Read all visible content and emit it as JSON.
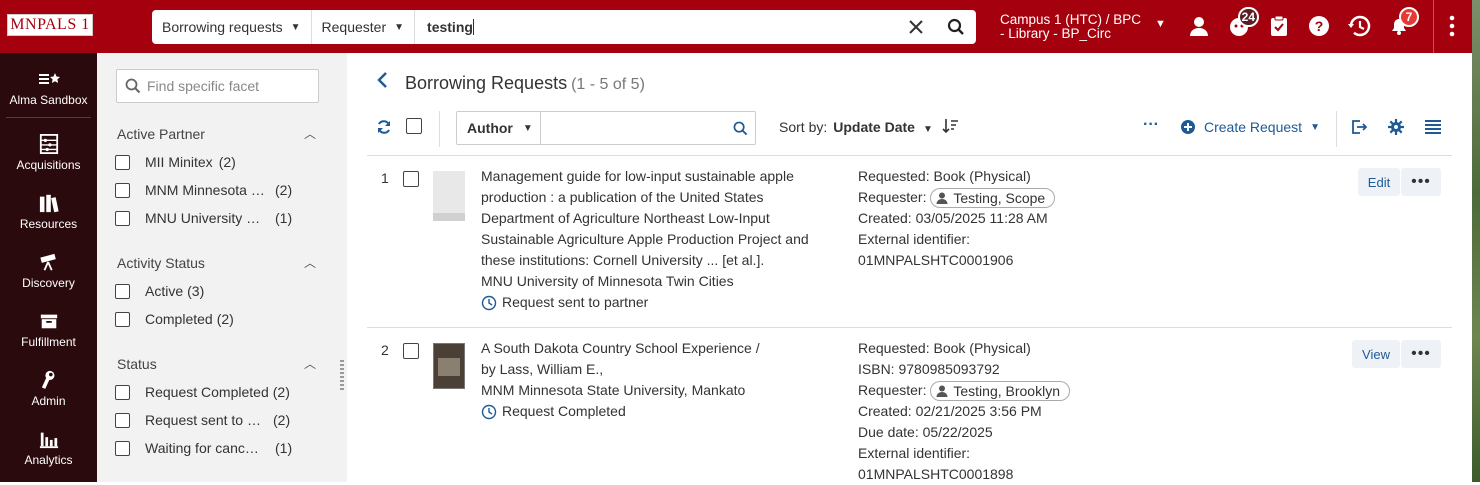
{
  "header": {
    "logo": "MNPALS 1",
    "search": {
      "scope": "Borrowing requests",
      "field": "Requester",
      "query": "testing"
    },
    "campus_line1": "Campus 1 (HTC) / BPC",
    "campus_line2": "- Library - BP_Circ",
    "tasks_badge": "24",
    "notifications_badge": "7"
  },
  "left_nav": [
    {
      "label": "Alma Sandbox",
      "icon": "sandbox-icon"
    },
    {
      "label": "Acquisitions",
      "icon": "abacus-icon"
    },
    {
      "label": "Resources",
      "icon": "books-icon"
    },
    {
      "label": "Discovery",
      "icon": "telescope-icon"
    },
    {
      "label": "Fulfillment",
      "icon": "inbox-icon"
    },
    {
      "label": "Admin",
      "icon": "wrench-icon"
    },
    {
      "label": "Analytics",
      "icon": "bar-chart-icon"
    }
  ],
  "facets": {
    "search_placeholder": "Find specific facet",
    "groups": [
      {
        "title": "Active Partner",
        "items": [
          {
            "label": "MII Minitex",
            "count": "(2)"
          },
          {
            "label": "MNM Minnesota State University, Mankato",
            "count": "(2)"
          },
          {
            "label": "MNU University of Minnesota Twin Cities",
            "count": "(1)"
          }
        ]
      },
      {
        "title": "Activity Status",
        "items": [
          {
            "label": "Active",
            "count": "(3)"
          },
          {
            "label": "Completed",
            "count": "(2)"
          }
        ]
      },
      {
        "title": "Status",
        "items": [
          {
            "label": "Request Completed",
            "count": "(2)"
          },
          {
            "label": "Request sent to partner",
            "count": "(2)"
          },
          {
            "label": "Waiting for cancellation",
            "count": "(1)"
          }
        ]
      }
    ]
  },
  "main": {
    "title": "Borrowing Requests",
    "count": "(1 - 5 of 5)",
    "filter_field": "Author",
    "sort_label": "Sort by:",
    "sort_value": "Update Date",
    "more": "···",
    "create_label": "Create Request"
  },
  "rows": [
    {
      "num": "1",
      "title": "Management guide for low-input sustainable apple production : a publication of the United States Department of Agriculture Northeast Low-Input Sustainable Agriculture Apple Production Project and these institutions: Cornell University ... [et al.].",
      "partner": "MNU University of Minnesota Twin Cities",
      "status": "Request sent to partner",
      "requested_label": "Requested:",
      "requested": "Book (Physical)",
      "requester_label": "Requester:",
      "requester": "Testing, Scope",
      "created_label": "Created:",
      "created": "03/05/2025 11:28 AM",
      "ext_label": "External identifier:",
      "ext_id": "01MNPALSHTC0001906",
      "action": "Edit"
    },
    {
      "num": "2",
      "title": "A South Dakota Country School Experience /",
      "author_line": "by Lass, William E.,",
      "partner": "MNM Minnesota State University, Mankato",
      "status": "Request Completed",
      "requested_label": "Requested:",
      "requested": "Book (Physical)",
      "isbn_label": "ISBN:",
      "isbn": "9780985093792",
      "requester_label": "Requester:",
      "requester": "Testing, Brooklyn",
      "created_label": "Created:",
      "created": "02/21/2025 3:56 PM",
      "due_label": "Due date:",
      "due": "05/22/2025",
      "ext_label": "External identifier:",
      "ext_id": "01MNPALSHTC0001898",
      "action": "View"
    }
  ]
}
